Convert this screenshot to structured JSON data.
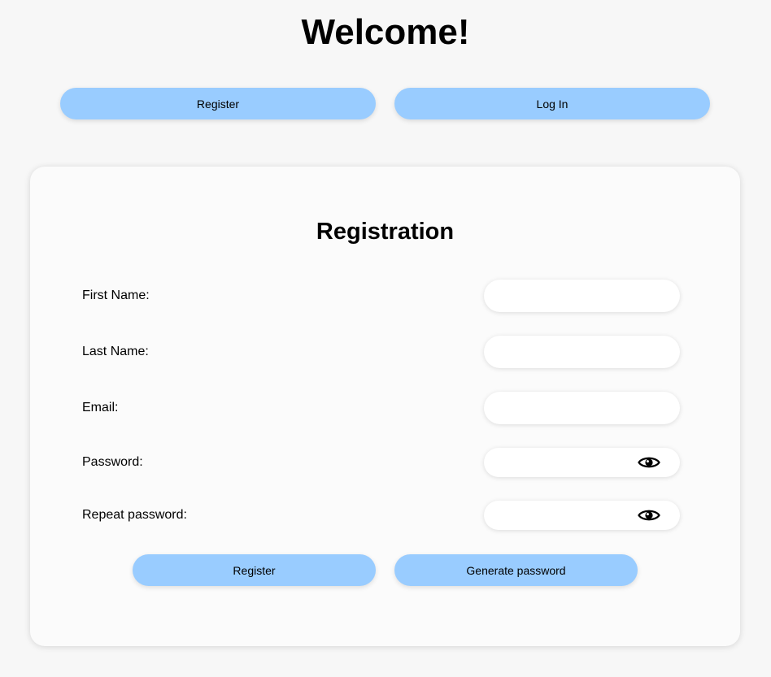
{
  "header": {
    "title": "Welcome!"
  },
  "nav": {
    "register_label": "Register",
    "login_label": "Log In"
  },
  "form": {
    "title": "Registration",
    "fields": {
      "first_name": {
        "label": "First Name:",
        "value": ""
      },
      "last_name": {
        "label": "Last Name:",
        "value": ""
      },
      "email": {
        "label": "Email:",
        "value": ""
      },
      "password": {
        "label": "Password:",
        "value": "",
        "toggle_icon": "eye-icon"
      },
      "repeat_password": {
        "label": "Repeat password:",
        "value": "",
        "toggle_icon": "eye-icon"
      }
    },
    "register_label": "Register",
    "generate_label": "Generate password"
  },
  "colors": {
    "button": "#99ccff",
    "background": "#f7f7f7",
    "card": "#fbfbfb",
    "field": "#ffffff"
  }
}
